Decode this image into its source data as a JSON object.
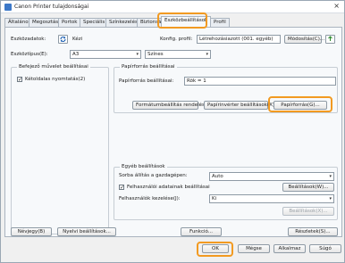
{
  "window": {
    "title": "Canon Printer tulajdonságai",
    "close_glyph": "×"
  },
  "tabs": [
    "Általános",
    "Megosztás",
    "Portok",
    "Speciális",
    "Színkezelés",
    "Biztonság",
    "Eszközbeállítások",
    "Profil"
  ],
  "top": {
    "device_label": "Eszközadatok:",
    "device_value": "Kézi",
    "profile_label": "Konfig. profil:",
    "profile_value": "Létrehozásiazott (001. egyéb)",
    "edit_button": "Módosítás(C)..."
  },
  "type_row": {
    "type_label": "Eszköztípus(E):",
    "type_value": "A3",
    "color_value": "Színes"
  },
  "left_group": {
    "title": "Befejező művelet beállításai",
    "checkbox_label": "Kétoldalas nyomtatás(2)",
    "checked": true
  },
  "paper_group": {
    "title": "Papírforrás beállításai",
    "source_label": "Papírforrás beállításai:",
    "source_value": "Rök = 1",
    "format_button": "Formátumbeállítás rendelése(Y)...",
    "insert_button": "Papírinvérter beállítások(X)...",
    "paperfeed_button": "Papírforrás(G)..."
  },
  "other_group": {
    "title": "Egyéb beállítások",
    "order_label": "Sorba állítás a gazdagépen:",
    "order_value": "Auto",
    "use_user_settings_label": "Felhasználói adatainak beállításai",
    "use_user_settings_checked": true,
    "settings_button": "Beállítások(W)...",
    "user_mgmt_label": "Felhasználók kezelése(J):",
    "user_mgmt_value": "Ki",
    "settings2_button": "Beállítások(X)..."
  },
  "bottom_row": {
    "about_button": "Névjegy(B)",
    "lang_button": "Nyelvi beállítások...",
    "func_button": "Funkció...",
    "details_button": "Részletek(S)..."
  },
  "footer": {
    "ok": "OK",
    "cancel": "Mégse",
    "apply": "Alkalmaz",
    "help": "Súgó"
  }
}
